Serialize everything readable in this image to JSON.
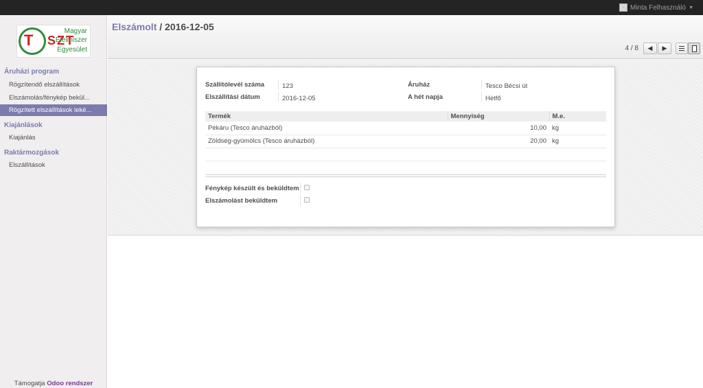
{
  "topbar": {
    "user_name": "Minta Felhasználó",
    "avatar_icon": "user-avatar-icon",
    "caret_icon": "caret-down-icon"
  },
  "logo": {
    "line1": "Magyar",
    "line2": "Élelmiszer",
    "line3": "Egyesület",
    "mark": "T·SZT"
  },
  "sidebar": {
    "sections": [
      {
        "title": "Áruházi program",
        "items": [
          {
            "label": "Rögzítendő elszállítások",
            "active": false
          },
          {
            "label": "Elszámolás/fénykép bekül...",
            "active": false
          },
          {
            "label": "Rögzített elszállítások leké...",
            "active": true
          }
        ]
      },
      {
        "title": "Kiajánlások",
        "items": [
          {
            "label": "Kiajánlás",
            "active": false
          }
        ]
      },
      {
        "title": "Raktármozgások",
        "items": [
          {
            "label": "Elszállítások",
            "active": false
          }
        ]
      }
    ],
    "powered_prefix": "Támogatja",
    "powered_brand": "Odoo rendszer"
  },
  "header": {
    "breadcrumb_parent": "Elszámolt",
    "breadcrumb_sep": " / ",
    "breadcrumb_current": "2016-12-05",
    "pager": "4 / 8",
    "prev_icon": "arrow-left-icon",
    "next_icon": "arrow-right-icon",
    "list_view_icon": "list-view-icon",
    "form_view_icon": "form-view-icon"
  },
  "form": {
    "fields": {
      "delivery_note_label": "Szállítólevél száma",
      "delivery_note_value": "123",
      "date_label": "Elszállítási dátum",
      "date_value": "2016-12-05",
      "store_label": "Áruház",
      "store_value": "Tesco Bécsi út",
      "weekday_label": "A hét napja",
      "weekday_value": "Hétfő"
    },
    "table": {
      "columns": [
        "Termék",
        "Mennyiség",
        "M.e."
      ],
      "rows": [
        {
          "product": "Pékáru (Tesco áruházból)",
          "qty": "10,00",
          "unit": "kg"
        },
        {
          "product": "Zöldség-gyümölcs (Tesco áruházból)",
          "qty": "20,00",
          "unit": "kg"
        }
      ]
    },
    "checks": {
      "photo_label": "Fénykép készült és beküldtem",
      "photo_checked": false,
      "settlement_label": "Elszámolást beküldtem",
      "settlement_checked": false
    }
  }
}
